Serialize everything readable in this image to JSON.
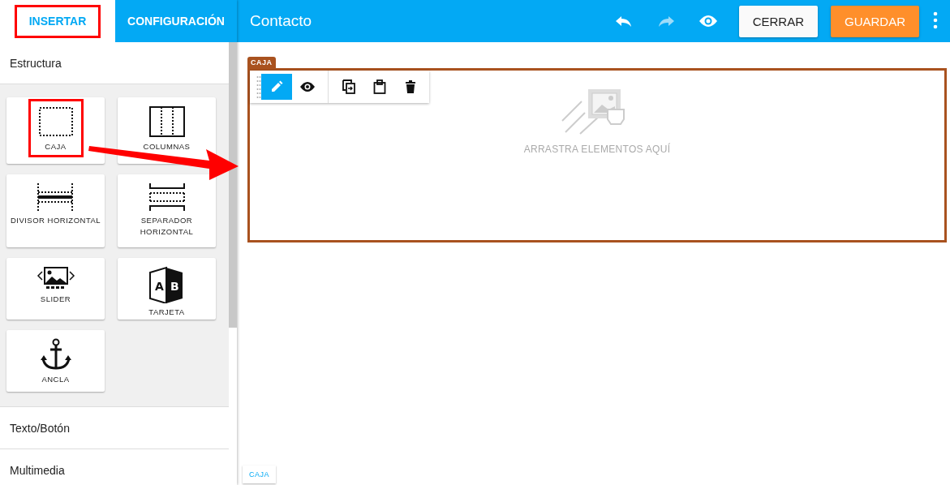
{
  "tabs": [
    {
      "label": "INSERTAR",
      "selected": true,
      "highlighted": true
    },
    {
      "label": "CONFIGURACIÓN",
      "selected": false,
      "highlighted": false
    }
  ],
  "header": {
    "title": "Contacto",
    "actions": [
      {
        "kind": "undo",
        "disabled": false
      },
      {
        "kind": "redo",
        "disabled": true
      },
      {
        "kind": "preview",
        "disabled": false
      }
    ],
    "buttons": [
      {
        "label": "CERRAR",
        "kind": "secondary"
      },
      {
        "label": "GUARDAR",
        "kind": "primary"
      }
    ]
  },
  "sidebar": {
    "sections": [
      {
        "title": "Estructura",
        "expanded": true,
        "blocks": [
          {
            "label": "CAJA",
            "kind": "box",
            "highlighted": true
          },
          {
            "label": "COLUMNAS",
            "kind": "columns",
            "highlighted": false
          },
          {
            "label": "DIVISOR HORIZONTAL",
            "kind": "divider",
            "highlighted": false
          },
          {
            "label": "SEPARADOR HORIZONTAL",
            "kind": "spacer",
            "highlighted": false
          },
          {
            "label": "SLIDER",
            "kind": "slider",
            "highlighted": false
          },
          {
            "label": "TARJETA",
            "kind": "card",
            "highlighted": false,
            "icon_letters": [
              "A",
              "B"
            ]
          },
          {
            "label": "ANCLA",
            "kind": "anchor",
            "highlighted": false
          }
        ]
      },
      {
        "title": "Texto/Botón",
        "expanded": false
      },
      {
        "title": "Multimedia",
        "expanded": false
      }
    ]
  },
  "canvas": {
    "element_tag": "CAJA",
    "tools": [
      {
        "kind": "edit",
        "selected": true
      },
      {
        "kind": "view",
        "selected": false
      },
      {
        "kind": "duplicate",
        "selected": false
      },
      {
        "kind": "paste",
        "selected": false
      },
      {
        "kind": "delete",
        "selected": false
      }
    ],
    "placeholder": "ARRASTRA ELEMENTOS AQUÍ",
    "breadcrumb": [
      "CAJA"
    ]
  }
}
